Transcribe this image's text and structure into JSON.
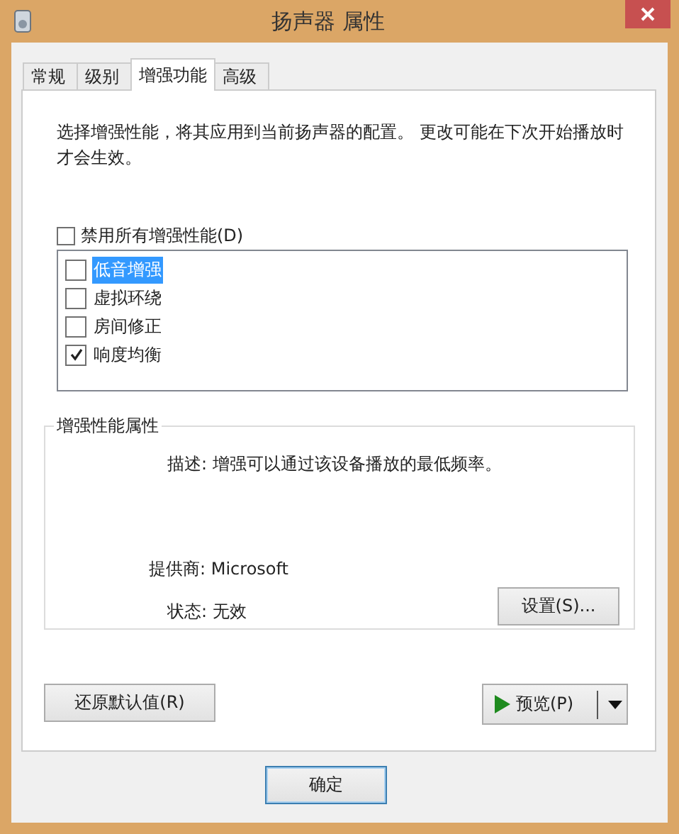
{
  "window": {
    "title": "扬声器 属性"
  },
  "tabs": [
    {
      "label": "常规",
      "selected": false
    },
    {
      "label": "级别",
      "selected": false
    },
    {
      "label": "增强功能",
      "selected": true
    },
    {
      "label": "高级",
      "selected": false
    }
  ],
  "description": "选择增强性能，将其应用到当前扬声器的配置。 更改可能在下次开始播放时才会生效。",
  "disable_all": {
    "label": "禁用所有增强性能(D)",
    "checked": false
  },
  "enhancements": [
    {
      "label": "低音增强",
      "checked": false,
      "selected": true
    },
    {
      "label": "虚拟环绕",
      "checked": false,
      "selected": false
    },
    {
      "label": "房间修正",
      "checked": false,
      "selected": false
    },
    {
      "label": "响度均衡",
      "checked": true,
      "selected": false
    }
  ],
  "properties": {
    "title": "增强性能属性",
    "description": "描述: 增强可以通过该设备播放的最低频率。",
    "provider": "提供商: Microsoft",
    "status": "状态: 无效",
    "settings_button": "设置(S)..."
  },
  "restore_button": "还原默认值(R)",
  "preview_button": "预览(P)",
  "dialog_buttons": [
    {
      "label": "确定",
      "default": true
    }
  ]
}
